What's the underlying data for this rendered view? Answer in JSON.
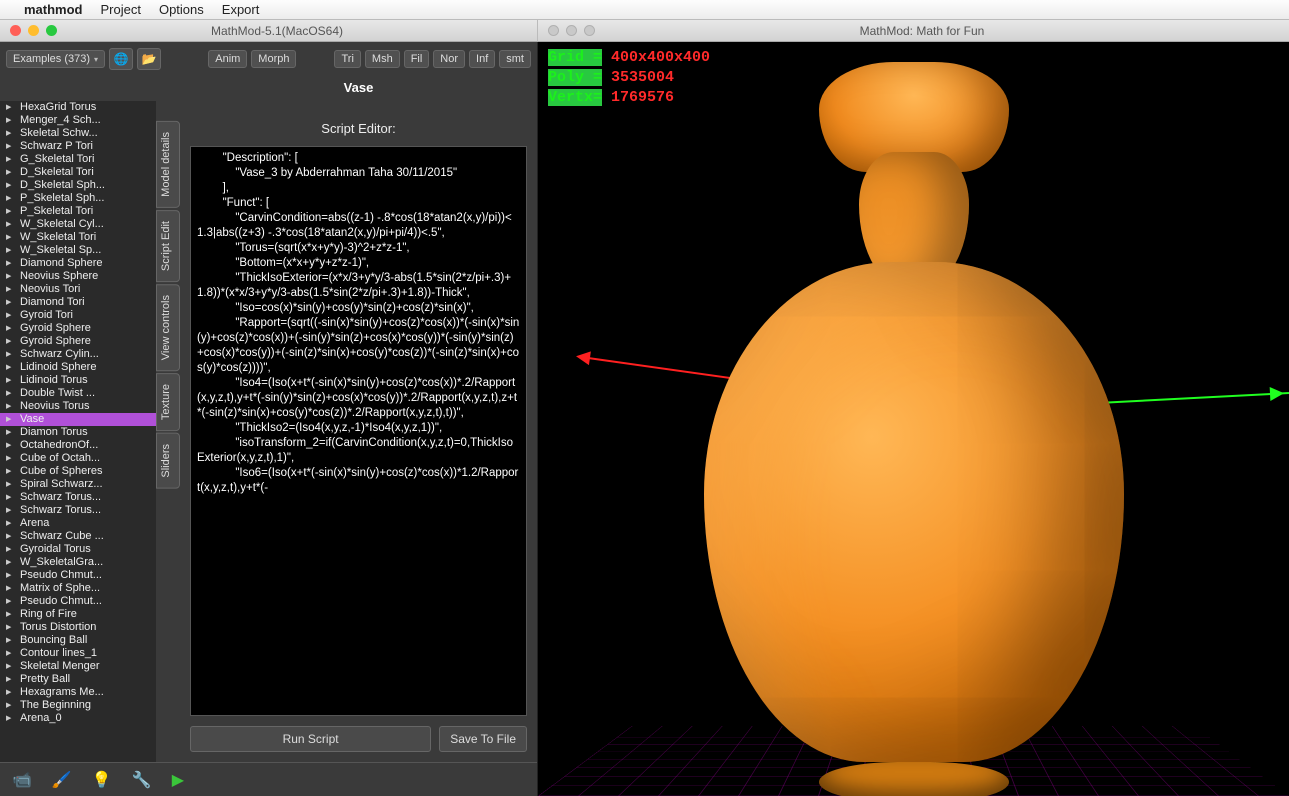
{
  "menubar": {
    "app": "mathmod",
    "items": [
      "Project",
      "Options",
      "Export"
    ]
  },
  "window_left_title": "MathMod-5.1(MacOS64)",
  "window_right_title": "MathMod: Math for Fun",
  "examples_label": "Examples (373)",
  "top_buttons": {
    "anim": "Anim",
    "morph": "Morph",
    "tri": "Tri",
    "msh": "Msh",
    "fil": "Fil",
    "nor": "Nor",
    "inf": "Inf",
    "smt": "smt"
  },
  "model_name": "Vase",
  "vtabs": [
    "Model details",
    "Script Edit",
    "View controls",
    "Texture",
    "Sliders"
  ],
  "editor_label": "Script Editor:",
  "run_label": "Run Script",
  "save_label": "Save To File",
  "script_text": "        \"Description\": [\n            \"Vase_3 by Abderrahman Taha 30/11/2015\"\n        ],\n        \"Funct\": [\n            \"CarvinCondition=abs((z-1) -.8*cos(18*atan2(x,y)/pi))<1.3|abs((z+3) -.3*cos(18*atan2(x,y)/pi+pi/4))<.5\",\n            \"Torus=(sqrt(x*x+y*y)-3)^2+z*z-1\",\n            \"Bottom=(x*x+y*y+z*z-1)\",\n            \"ThickIsoExterior=(x*x/3+y*y/3-abs(1.5*sin(2*z/pi+.3)+1.8))*(x*x/3+y*y/3-abs(1.5*sin(2*z/pi+.3)+1.8))-Thick\",\n            \"Iso=cos(x)*sin(y)+cos(y)*sin(z)+cos(z)*sin(x)\",\n            \"Rapport=(sqrt((-sin(x)*sin(y)+cos(z)*cos(x))*(-sin(x)*sin(y)+cos(z)*cos(x))+(-sin(y)*sin(z)+cos(x)*cos(y))*(-sin(y)*sin(z)+cos(x)*cos(y))+(-sin(z)*sin(x)+cos(y)*cos(z))*(-sin(z)*sin(x)+cos(y)*cos(z))))\",\n            \"Iso4=(Iso(x+t*(-sin(x)*sin(y)+cos(z)*cos(x))*.2/Rapport(x,y,z,t),y+t*(-sin(y)*sin(z)+cos(x)*cos(y))*.2/Rapport(x,y,z,t),z+t*(-sin(z)*sin(x)+cos(y)*cos(z))*.2/Rapport(x,y,z,t),t))\",\n            \"ThickIso2=(Iso4(x,y,z,-1)*Iso4(x,y,z,1))\",\n            \"isoTransform_2=if(CarvinCondition(x,y,z,t)=0,ThickIsoExterior(x,y,z,t),1)\",\n            \"Iso6=(Iso(x+t*(-sin(x)*sin(y)+cos(z)*cos(x))*1.2/Rapport(x,y,z,t),y+t*(-",
  "tree_items": [
    "HexaGrid Torus",
    "Menger_4 Sch...",
    "Skeletal Schw...",
    "Schwarz P Tori",
    "G_Skeletal Tori",
    "D_Skeletal Tori",
    "D_Skeletal Sph...",
    "P_Skeletal Sph...",
    "P_Skeletal Tori",
    "W_Skeletal Cyl...",
    "W_Skeletal Tori",
    "W_Skeletal Sp...",
    "Diamond Sphere",
    "Neovius Sphere",
    "Neovius Tori",
    "Diamond Tori",
    "Gyroid Tori",
    "Gyroid Sphere",
    "Gyroid Sphere",
    "Schwarz Cylin...",
    "Lidinoid Sphere",
    "Lidinoid Torus",
    "Double Twist ...",
    "Neovius Torus",
    "Vase",
    "Diamon Torus",
    "OctahedronOf...",
    "Cube of Octah...",
    "Cube of Spheres",
    "Spiral Schwarz...",
    "Schwarz Torus...",
    "Schwarz Torus...",
    "Arena",
    "Schwarz Cube ...",
    "Gyroidal Torus",
    "W_SkeletalGra...",
    "Pseudo Chmut...",
    "Matrix of Sphe...",
    "Pseudo Chmut...",
    "Ring of Fire",
    "Torus Distortion",
    "Bouncing Ball",
    "Contour lines_1",
    "Skeletal Menger",
    "Pretty Ball",
    "Hexagrams Me...",
    "The Beginning",
    "Arena_0"
  ],
  "tree_selected_index": 24,
  "stats": {
    "grid_label": "Grid  =",
    "grid_value": "400x400x400",
    "poly_label": "Poly  =",
    "poly_value": "3535004",
    "vert_label": "Vertx=",
    "vert_value": "1769576"
  }
}
